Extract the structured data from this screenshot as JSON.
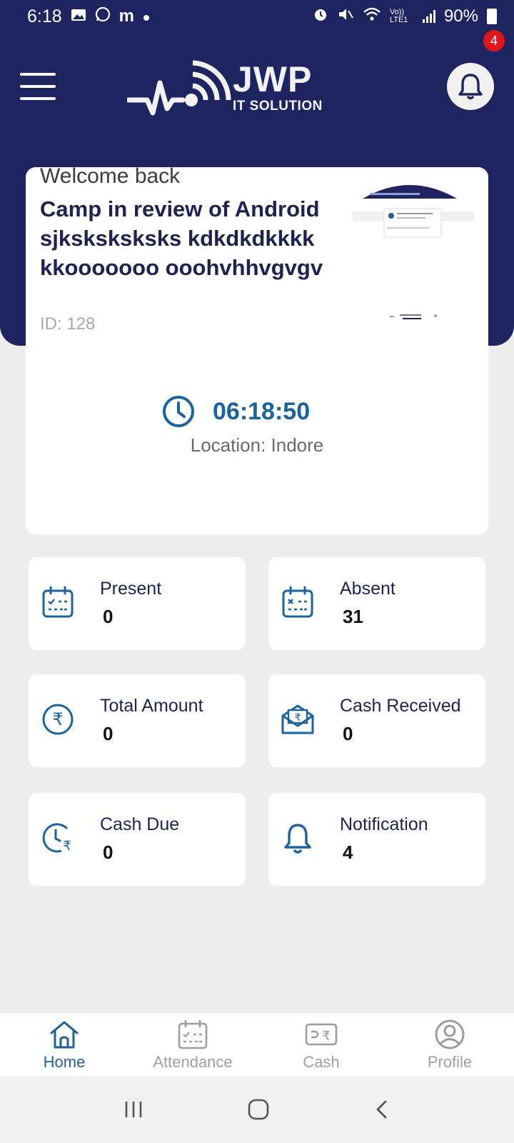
{
  "status_bar": {
    "time": "6:18",
    "left_icons": [
      "gallery-icon",
      "whatsapp-icon",
      "m-app-icon",
      "dot-icon"
    ],
    "right_icons": [
      "alarm-icon",
      "mute-icon",
      "wifi-icon",
      "volte-icon",
      "signal-icon"
    ],
    "network_label": "Vo)) LTE1",
    "battery": "90%"
  },
  "header": {
    "logo_main": "JWP",
    "logo_sub": "IT SOLUTION",
    "notification_badge": "4"
  },
  "welcome_card": {
    "greeting": "Welcome back",
    "camp_title": "Camp in review of Android sjksksksksks kdkdkdkkkkkkooooooo ooohvhhvgvgv",
    "camp_id": "ID: 128",
    "timer": "06:18:50",
    "location": "Location: Indore"
  },
  "stats": [
    {
      "label": "Present",
      "value": "0",
      "icon": "calendar-check-icon"
    },
    {
      "label": "Absent",
      "value": "31",
      "icon": "calendar-x-icon"
    },
    {
      "label": "Total Amount",
      "value": "0",
      "icon": "rupee-circle-icon"
    },
    {
      "label": "Cash Received",
      "value": "0",
      "icon": "rupee-envelope-icon"
    },
    {
      "label": "Cash Due",
      "value": "0",
      "icon": "clock-rupee-icon"
    },
    {
      "label": "Notification",
      "value": "4",
      "icon": "bell-icon"
    }
  ],
  "bottom_nav": [
    {
      "label": "Home",
      "icon": "home-icon",
      "active": true
    },
    {
      "label": "Attendance",
      "icon": "calendar-icon",
      "active": false
    },
    {
      "label": "Cash",
      "icon": "cash-icon",
      "active": false
    },
    {
      "label": "Profile",
      "icon": "profile-icon",
      "active": false
    }
  ],
  "colors": {
    "primary_navy": "#1e2460",
    "accent_blue": "#1a63a0",
    "badge_red": "#e3151c",
    "background": "#ededed"
  }
}
